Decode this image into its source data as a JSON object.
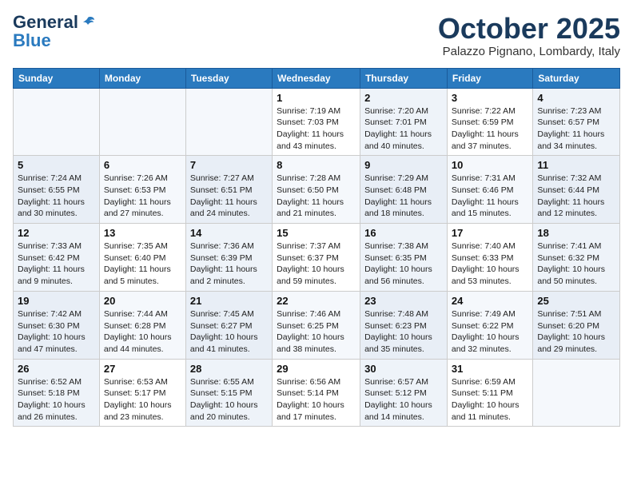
{
  "header": {
    "logo_line1": "General",
    "logo_line2": "Blue",
    "month": "October 2025",
    "location": "Palazzo Pignano, Lombardy, Italy"
  },
  "weekdays": [
    "Sunday",
    "Monday",
    "Tuesday",
    "Wednesday",
    "Thursday",
    "Friday",
    "Saturday"
  ],
  "weeks": [
    [
      {
        "day": "",
        "info": ""
      },
      {
        "day": "",
        "info": ""
      },
      {
        "day": "",
        "info": ""
      },
      {
        "day": "1",
        "info": "Sunrise: 7:19 AM\nSunset: 7:03 PM\nDaylight: 11 hours\nand 43 minutes."
      },
      {
        "day": "2",
        "info": "Sunrise: 7:20 AM\nSunset: 7:01 PM\nDaylight: 11 hours\nand 40 minutes."
      },
      {
        "day": "3",
        "info": "Sunrise: 7:22 AM\nSunset: 6:59 PM\nDaylight: 11 hours\nand 37 minutes."
      },
      {
        "day": "4",
        "info": "Sunrise: 7:23 AM\nSunset: 6:57 PM\nDaylight: 11 hours\nand 34 minutes."
      }
    ],
    [
      {
        "day": "5",
        "info": "Sunrise: 7:24 AM\nSunset: 6:55 PM\nDaylight: 11 hours\nand 30 minutes."
      },
      {
        "day": "6",
        "info": "Sunrise: 7:26 AM\nSunset: 6:53 PM\nDaylight: 11 hours\nand 27 minutes."
      },
      {
        "day": "7",
        "info": "Sunrise: 7:27 AM\nSunset: 6:51 PM\nDaylight: 11 hours\nand 24 minutes."
      },
      {
        "day": "8",
        "info": "Sunrise: 7:28 AM\nSunset: 6:50 PM\nDaylight: 11 hours\nand 21 minutes."
      },
      {
        "day": "9",
        "info": "Sunrise: 7:29 AM\nSunset: 6:48 PM\nDaylight: 11 hours\nand 18 minutes."
      },
      {
        "day": "10",
        "info": "Sunrise: 7:31 AM\nSunset: 6:46 PM\nDaylight: 11 hours\nand 15 minutes."
      },
      {
        "day": "11",
        "info": "Sunrise: 7:32 AM\nSunset: 6:44 PM\nDaylight: 11 hours\nand 12 minutes."
      }
    ],
    [
      {
        "day": "12",
        "info": "Sunrise: 7:33 AM\nSunset: 6:42 PM\nDaylight: 11 hours\nand 9 minutes."
      },
      {
        "day": "13",
        "info": "Sunrise: 7:35 AM\nSunset: 6:40 PM\nDaylight: 11 hours\nand 5 minutes."
      },
      {
        "day": "14",
        "info": "Sunrise: 7:36 AM\nSunset: 6:39 PM\nDaylight: 11 hours\nand 2 minutes."
      },
      {
        "day": "15",
        "info": "Sunrise: 7:37 AM\nSunset: 6:37 PM\nDaylight: 10 hours\nand 59 minutes."
      },
      {
        "day": "16",
        "info": "Sunrise: 7:38 AM\nSunset: 6:35 PM\nDaylight: 10 hours\nand 56 minutes."
      },
      {
        "day": "17",
        "info": "Sunrise: 7:40 AM\nSunset: 6:33 PM\nDaylight: 10 hours\nand 53 minutes."
      },
      {
        "day": "18",
        "info": "Sunrise: 7:41 AM\nSunset: 6:32 PM\nDaylight: 10 hours\nand 50 minutes."
      }
    ],
    [
      {
        "day": "19",
        "info": "Sunrise: 7:42 AM\nSunset: 6:30 PM\nDaylight: 10 hours\nand 47 minutes."
      },
      {
        "day": "20",
        "info": "Sunrise: 7:44 AM\nSunset: 6:28 PM\nDaylight: 10 hours\nand 44 minutes."
      },
      {
        "day": "21",
        "info": "Sunrise: 7:45 AM\nSunset: 6:27 PM\nDaylight: 10 hours\nand 41 minutes."
      },
      {
        "day": "22",
        "info": "Sunrise: 7:46 AM\nSunset: 6:25 PM\nDaylight: 10 hours\nand 38 minutes."
      },
      {
        "day": "23",
        "info": "Sunrise: 7:48 AM\nSunset: 6:23 PM\nDaylight: 10 hours\nand 35 minutes."
      },
      {
        "day": "24",
        "info": "Sunrise: 7:49 AM\nSunset: 6:22 PM\nDaylight: 10 hours\nand 32 minutes."
      },
      {
        "day": "25",
        "info": "Sunrise: 7:51 AM\nSunset: 6:20 PM\nDaylight: 10 hours\nand 29 minutes."
      }
    ],
    [
      {
        "day": "26",
        "info": "Sunrise: 6:52 AM\nSunset: 5:18 PM\nDaylight: 10 hours\nand 26 minutes."
      },
      {
        "day": "27",
        "info": "Sunrise: 6:53 AM\nSunset: 5:17 PM\nDaylight: 10 hours\nand 23 minutes."
      },
      {
        "day": "28",
        "info": "Sunrise: 6:55 AM\nSunset: 5:15 PM\nDaylight: 10 hours\nand 20 minutes."
      },
      {
        "day": "29",
        "info": "Sunrise: 6:56 AM\nSunset: 5:14 PM\nDaylight: 10 hours\nand 17 minutes."
      },
      {
        "day": "30",
        "info": "Sunrise: 6:57 AM\nSunset: 5:12 PM\nDaylight: 10 hours\nand 14 minutes."
      },
      {
        "day": "31",
        "info": "Sunrise: 6:59 AM\nSunset: 5:11 PM\nDaylight: 10 hours\nand 11 minutes."
      },
      {
        "day": "",
        "info": ""
      }
    ]
  ]
}
